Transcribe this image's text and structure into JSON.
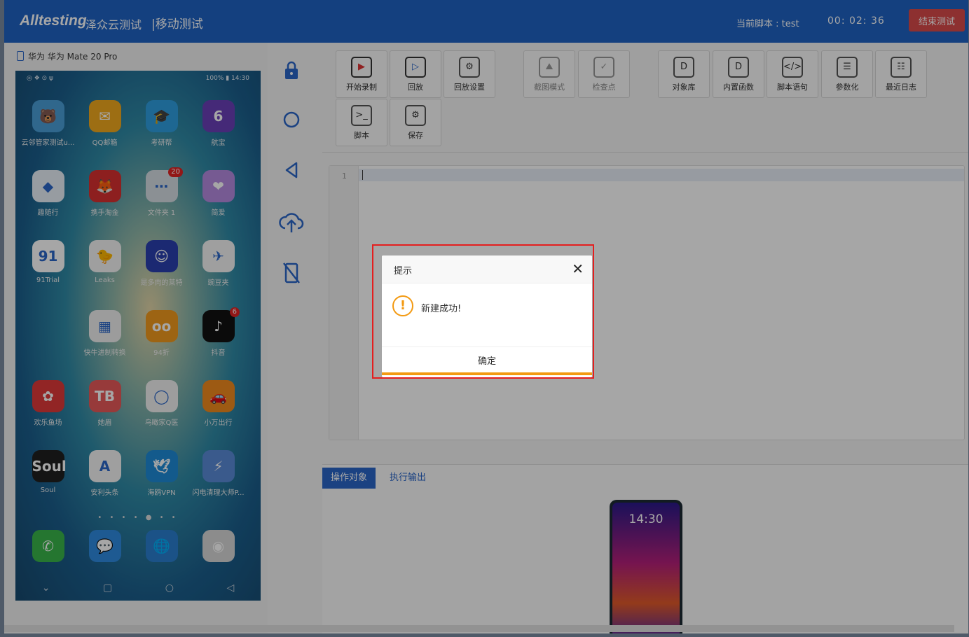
{
  "header": {
    "logo": "Alltesting",
    "logo_cn": "泽众云测试",
    "module": "|移动测试",
    "current_script": "当前脚本 : test",
    "timer": "00:  02:  36",
    "end_button": "结束测试"
  },
  "device": {
    "name": "华为 华为 Mate 20 Pro",
    "status_left": "◎ ❖ ⊙ ψ",
    "status_right": "100% ▮ 14:30",
    "apps": [
      [
        {
          "label": "云邻管家测试u...",
          "color": "#4a9fd8",
          "glyph": "🐻"
        },
        {
          "label": "QQ邮箱",
          "color": "#f2a91e",
          "glyph": "✉"
        },
        {
          "label": "考研帮",
          "color": "#2f9ee0",
          "glyph": "🎓"
        },
        {
          "label": "航宝",
          "color": "#6b3fb8",
          "glyph": "6"
        }
      ],
      [
        {
          "label": "趣随行",
          "color": "#e8f0f8",
          "glyph": "◆"
        },
        {
          "label": "携手淘金",
          "color": "#d93030",
          "glyph": "🦊"
        },
        {
          "label": "文件夹 1",
          "color": "#d6dde3",
          "glyph": "⋯",
          "badge": "20"
        },
        {
          "label": "简爱",
          "color": "#b58be0",
          "glyph": "❤"
        }
      ],
      [
        {
          "label": "91Trial",
          "color": "#ffffff",
          "glyph": "91"
        },
        {
          "label": "Leaks",
          "color": "#f5f5f5",
          "glyph": "🐤"
        },
        {
          "label": "是多肉的莱特",
          "color": "#2a3fb0",
          "glyph": "☺"
        },
        {
          "label": "豌豆夹",
          "color": "#f5f5f5",
          "glyph": "✈"
        }
      ],
      [
        {
          "label": "",
          "color": "transparent",
          "glyph": ""
        },
        {
          "label": "快牛进制转换",
          "color": "#f0f0f0",
          "glyph": "▦"
        },
        {
          "label": "94折",
          "color": "#f29a1e",
          "glyph": "oo"
        },
        {
          "label": "抖音",
          "color": "#111111",
          "glyph": "♪",
          "badge": "6"
        }
      ],
      [
        {
          "label": "欢乐鱼场",
          "color": "#e03a3a",
          "glyph": "✿"
        },
        {
          "label": "她眉",
          "color": "#e85a5a",
          "glyph": "TB"
        },
        {
          "label": "鸟瞰家Q医",
          "color": "#f2f2f2",
          "glyph": "◯"
        },
        {
          "label": "小万出行",
          "color": "#f28a1e",
          "glyph": "🚗"
        }
      ],
      [
        {
          "label": "Soul",
          "color": "#202020",
          "glyph": "Soul"
        },
        {
          "label": "安利头条",
          "color": "#f5f5f5",
          "glyph": "A"
        },
        {
          "label": "海鸥VPN",
          "color": "#1e8ad8",
          "glyph": "🕊"
        },
        {
          "label": "闪电清理大师P...",
          "color": "#5a8ad8",
          "glyph": "⚡"
        }
      ]
    ],
    "page_dots": "• • • • ● • •",
    "dock": [
      {
        "color": "#3ab54a",
        "glyph": "✆"
      },
      {
        "color": "#2f8ae0",
        "glyph": "💬"
      },
      {
        "color": "#2a7ed0",
        "glyph": "🌐"
      },
      {
        "color": "#d8d8d8",
        "glyph": "◉"
      }
    ],
    "nav": [
      "⌄",
      "▢",
      "○",
      "◁"
    ]
  },
  "side_tools": [
    "lock-icon",
    "home-icon",
    "back-icon",
    "upload-icon",
    "rotate-icon"
  ],
  "toolbar": {
    "buttons": [
      {
        "label": "开始录制",
        "glyph": "▶",
        "style": "red",
        "disabled": false
      },
      {
        "label": "回放",
        "glyph": "▷",
        "style": "blue",
        "disabled": false
      },
      {
        "label": "回放设置",
        "glyph": "⚙",
        "style": "",
        "disabled": false
      },
      {
        "label": "截图模式",
        "glyph": "⛰",
        "style": "",
        "disabled": true
      },
      {
        "label": "检查点",
        "glyph": "✓",
        "style": "",
        "disabled": true
      },
      {
        "label": "对象库",
        "glyph": "D",
        "style": "",
        "disabled": false
      },
      {
        "label": "内置函数",
        "glyph": "D",
        "style": "",
        "disabled": false
      },
      {
        "label": "脚本语句",
        "glyph": "</>",
        "style": "",
        "disabled": false
      },
      {
        "label": "参数化",
        "glyph": "☰",
        "style": "",
        "disabled": false
      },
      {
        "label": "最近日志",
        "glyph": "☷",
        "style": "",
        "disabled": false
      },
      {
        "label": "脚本",
        "glyph": ">_",
        "style": "",
        "disabled": false
      },
      {
        "label": "保存",
        "glyph": "⚙",
        "style": "",
        "disabled": false
      }
    ]
  },
  "editor": {
    "line_number": "1"
  },
  "bottom": {
    "tabs": [
      "操作对象",
      "执行输出"
    ],
    "preview_time": "14:30"
  },
  "dialog": {
    "title": "提示",
    "close": "✕",
    "message": "新建成功!",
    "ok": "确定"
  }
}
